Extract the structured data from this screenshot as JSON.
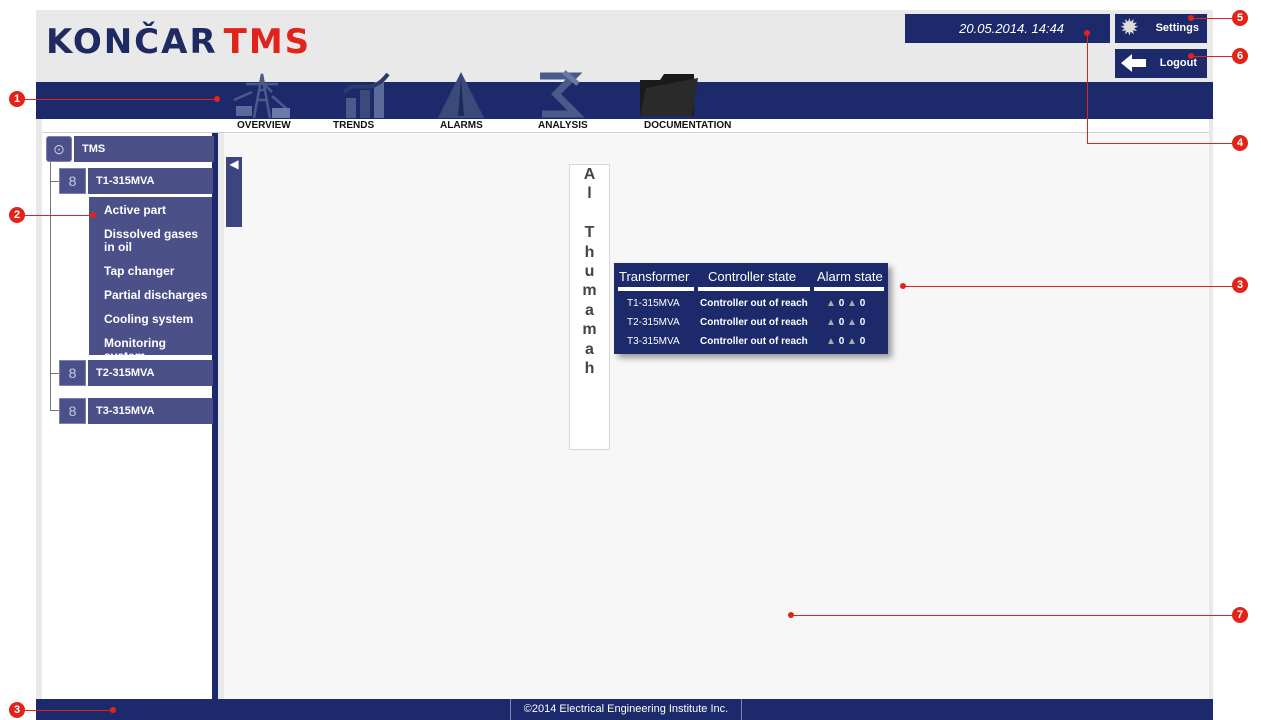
{
  "header": {
    "logo_brand": "KONČAR",
    "logo_product": "TMS",
    "datetime": "20.05.2014. 14:44",
    "settings_label": "Settings",
    "logout_label": "Logout"
  },
  "nav": {
    "items": [
      {
        "label": "OVERVIEW",
        "icon": "transmission-tower-icon"
      },
      {
        "label": "TRENDS",
        "icon": "trend-chart-icon"
      },
      {
        "label": "ALARMS",
        "icon": "warning-icon"
      },
      {
        "label": "ANALYSIS",
        "icon": "analysis-sigma-icon"
      },
      {
        "label": "DOCUMENTATION",
        "icon": "folder-icon"
      }
    ]
  },
  "sidebar": {
    "root": "TMS",
    "transformers": [
      {
        "label": "T1-315MVA",
        "expanded": true,
        "children": [
          "Active part",
          "Dissolved gases in oil",
          "Tap changer",
          "Partial discharges",
          "Cooling system",
          "Monitoring system"
        ]
      },
      {
        "label": "T2-315MVA",
        "expanded": false,
        "children": []
      },
      {
        "label": "T3-315MVA",
        "expanded": false,
        "children": []
      }
    ]
  },
  "content": {
    "vertical_title_letters": [
      "A",
      "l",
      "",
      "T",
      "h",
      "u",
      "m",
      "a",
      "m",
      "a",
      "h"
    ],
    "table": {
      "headers": [
        "Transformer",
        "Controller state",
        "Alarm state"
      ],
      "rows": [
        {
          "transformer": "T1-315MVA",
          "state": "Controller out of reach",
          "alarms_a": "0",
          "alarms_b": "0"
        },
        {
          "transformer": "T2-315MVA",
          "state": "Controller out of reach",
          "alarms_a": "0",
          "alarms_b": "0"
        },
        {
          "transformer": "T3-315MVA",
          "state": "Controller out of reach",
          "alarms_a": "0",
          "alarms_b": "0"
        }
      ]
    }
  },
  "footer": {
    "copyright": "©2014 Electrical Engineering Institute Inc."
  },
  "callouts": [
    "1",
    "2",
    "3",
    "3",
    "4",
    "5",
    "6",
    "7"
  ],
  "colors": {
    "navy": "#1c2a6b",
    "tree_purple": "#4c5088",
    "brand_red": "#e2231a"
  }
}
